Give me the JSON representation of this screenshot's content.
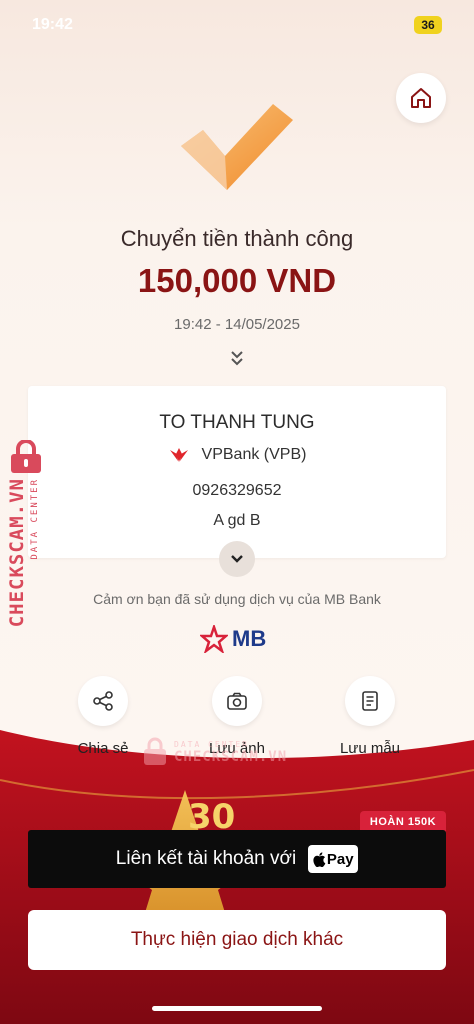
{
  "status_bar": {
    "time": "19:42",
    "battery": "36"
  },
  "transfer": {
    "title": "Chuyển tiền thành công",
    "amount": "150,000 VND",
    "datetime": "19:42 - 14/05/2025"
  },
  "recipient": {
    "name": "TO THANH TUNG",
    "bank": "VPBank (VPB)",
    "account": "0926329652",
    "memo": "A gd B"
  },
  "footer_note": "Cảm ơn bạn đã sử dụng dịch vụ của MB Bank",
  "brand": {
    "logo_text": "MB",
    "color": "#1e3a8a",
    "accent": "#d8223a"
  },
  "actions": [
    {
      "label": "Chia sẻ",
      "icon": "share-icon"
    },
    {
      "label": "Lưu ảnh",
      "icon": "camera-icon"
    },
    {
      "label": "Lưu mẫu",
      "icon": "template-icon"
    }
  ],
  "promo": {
    "badge": "HOÀN 150K",
    "label": "Liên kết tài khoản với",
    "pay_text": "Pay",
    "banner_text": "30"
  },
  "secondary_button": {
    "label": "Thực hiện giao dịch khác"
  },
  "watermark": {
    "small": "DATA CENTER",
    "big": "CHECKSCAM.VN"
  },
  "colors": {
    "amount": "#8a1414",
    "background": "#fbf1ea",
    "bottom_banner": "#a8101c",
    "check_orange": "#f39a3a"
  }
}
